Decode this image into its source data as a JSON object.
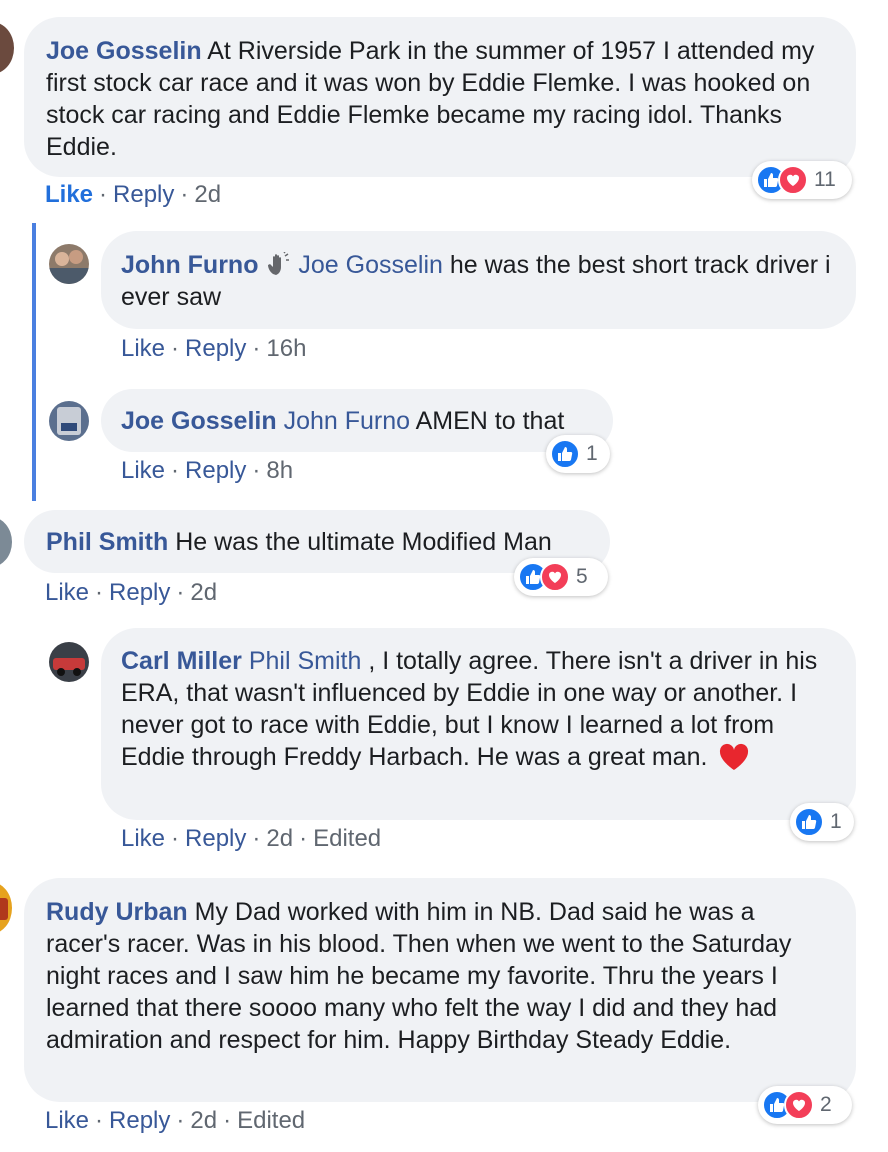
{
  "comments": [
    {
      "author": "Joe Gosselin",
      "text": "At Riverside Park in the summer of 1957 I attended my first stock car race and it was won by Eddie Flemke. I was hooked on stock car racing and Eddie Flemke became my racing idol. Thanks Eddie.",
      "like": "Like",
      "reply": "Reply",
      "time": "2d",
      "reactions": {
        "types": [
          "like",
          "love"
        ],
        "count": "11"
      }
    },
    {
      "author": "John Furno",
      "mention": "Joe Gosselin",
      "text": "he was the best short track driver i ever saw",
      "like": "Like",
      "reply": "Reply",
      "time": "16h"
    },
    {
      "author": "Joe Gosselin",
      "mention": "John Furno",
      "text": "AMEN to that",
      "like": "Like",
      "reply": "Reply",
      "time": "8h",
      "reactions": {
        "types": [
          "like"
        ],
        "count": "1"
      }
    },
    {
      "author": "Phil Smith",
      "text": "He was the ultimate Modified Man",
      "like": "Like",
      "reply": "Reply",
      "time": "2d",
      "reactions": {
        "types": [
          "like",
          "love"
        ],
        "count": "5"
      }
    },
    {
      "author": "Carl Miller",
      "mention": "Phil Smith",
      "text": ", I totally agree. There isn't a driver in his ERA, that wasn't influenced by Eddie in one way or another. I never got to race with Eddie, but I know I learned a lot from Eddie through Freddy Harbach. He was a great man.",
      "like": "Like",
      "reply": "Reply",
      "time": "2d",
      "edited": "Edited",
      "reactions": {
        "types": [
          "like"
        ],
        "count": "1"
      }
    },
    {
      "author": "Rudy Urban",
      "text": "My Dad worked with him in NB. Dad said he was a racer's racer. Was in his blood. Then when we went to the Saturday night races and I saw him he became my favorite. Thru the years I learned that there soooo many who felt the way I did and they had admiration and respect for him. Happy Birthday Steady Eddie.",
      "like": "Like",
      "reply": "Reply",
      "time": "2d",
      "edited": "Edited",
      "reactions": {
        "types": [
          "like",
          "love"
        ],
        "count": "2"
      }
    }
  ],
  "colors": {
    "link": "#385898",
    "bubble": "#f0f2f5",
    "like": "#1877f2",
    "love": "#f33e58",
    "thread": "#4a7fe0"
  }
}
